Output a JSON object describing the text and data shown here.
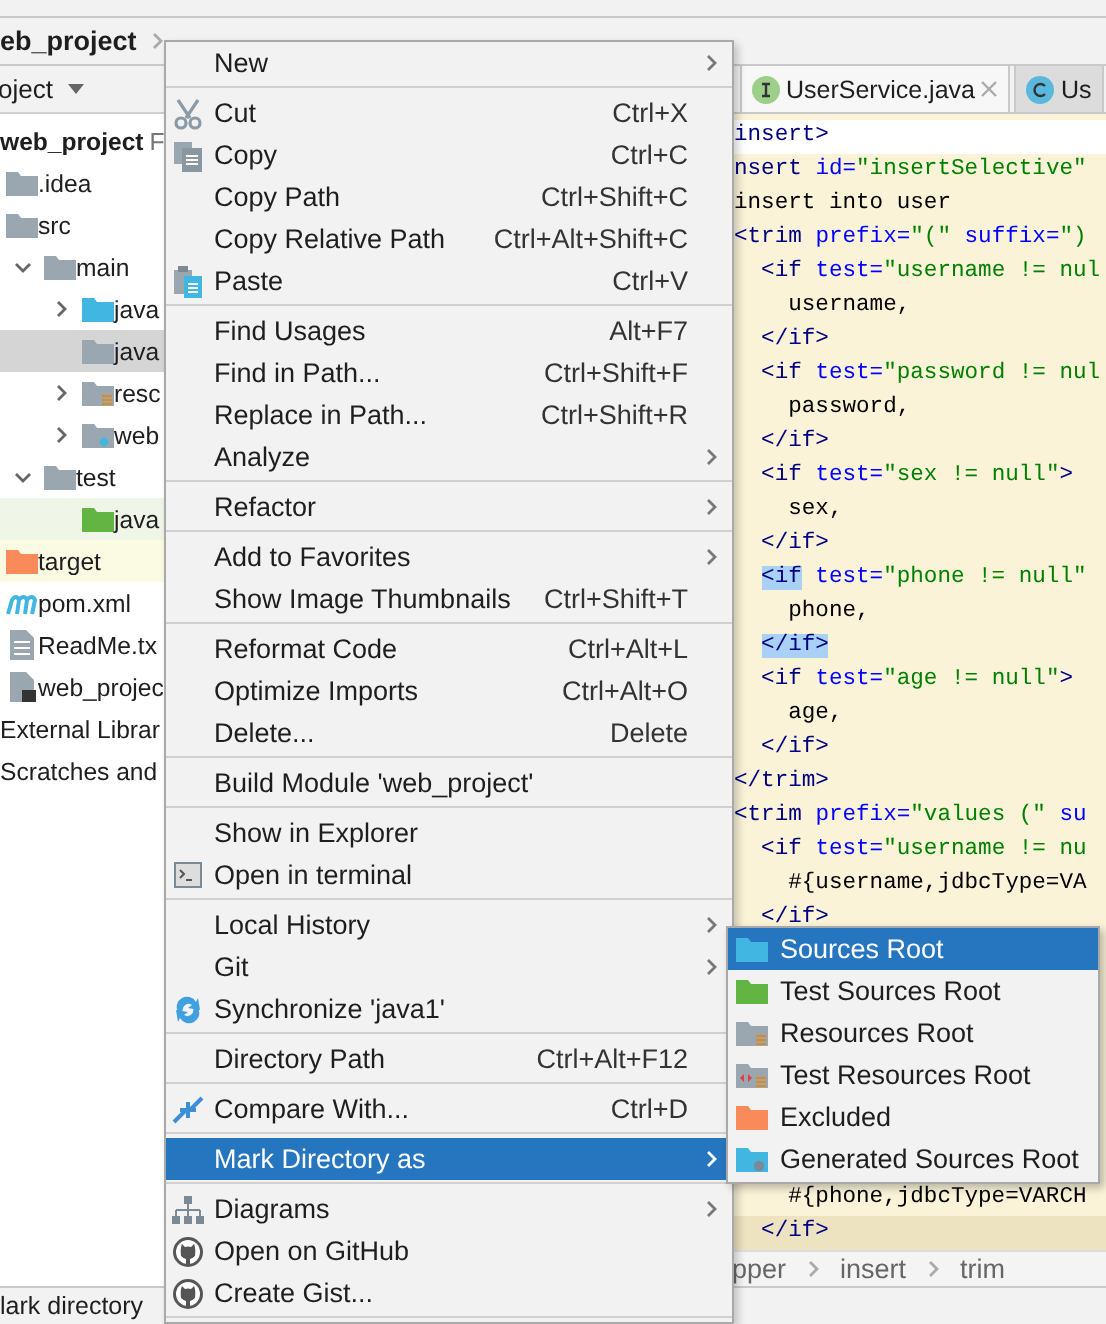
{
  "nav_bar": {
    "project": "eb_project"
  },
  "project_panel": {
    "title": "oject",
    "tree": [
      {
        "label": "web_project",
        "path": "F",
        "selected": false,
        "children": [
          {
            "label": ".idea",
            "kind": "folder",
            "selected": false
          },
          {
            "label": "src",
            "kind": "folder",
            "selected": false,
            "children": [
              {
                "label": "main",
                "kind": "folder",
                "expanded": true,
                "selected": false,
                "children": [
                  {
                    "label": "java",
                    "kind": "source",
                    "expanded": false,
                    "selected": false
                  },
                  {
                    "label": "java",
                    "kind": "folder",
                    "selected": true
                  },
                  {
                    "label": "resc",
                    "kind": "resources",
                    "expanded": false,
                    "selected": false
                  },
                  {
                    "label": "web",
                    "kind": "web",
                    "expanded": false,
                    "selected": false
                  }
                ]
              },
              {
                "label": "test",
                "kind": "folder",
                "expanded": true,
                "selected": false,
                "children": [
                  {
                    "label": "java",
                    "kind": "test",
                    "selected": false,
                    "color": "#eff6e8"
                  }
                ]
              }
            ]
          },
          {
            "label": "target",
            "kind": "excluded",
            "selected": false,
            "color": "#fbfbe3"
          },
          {
            "label": "pom.xml",
            "kind": "maven",
            "selected": false
          },
          {
            "label": "ReadMe.tx",
            "kind": "text",
            "selected": false
          },
          {
            "label": "web_projec",
            "kind": "module",
            "selected": false
          }
        ]
      },
      {
        "label": "External Librar",
        "selected": false
      },
      {
        "label": "Scratches and",
        "selected": false
      }
    ]
  },
  "editor": {
    "tabs": [
      {
        "label": "UserService.java",
        "kind": "interface",
        "closable": true,
        "selected": true
      },
      {
        "label": "Us",
        "kind": "class",
        "closable": false,
        "selected": false
      }
    ],
    "lines": [
      {
        "highlighted": false,
        "tokens": [
          {
            "kind": "tag",
            "text": "insert>"
          }
        ]
      },
      {
        "highlighted": true,
        "tokens": [
          {
            "kind": "tag",
            "text": "nsert "
          },
          {
            "kind": "attr",
            "text": "id="
          },
          {
            "kind": "string",
            "text": "\"insertSelective\""
          }
        ]
      },
      {
        "highlighted": true,
        "tokens": [
          {
            "kind": "text",
            "text": "insert into user"
          }
        ]
      },
      {
        "highlighted": true,
        "tokens": [
          {
            "kind": "tag",
            "text": "<trim "
          },
          {
            "kind": "attr",
            "text": "prefix="
          },
          {
            "kind": "string",
            "text": "\"(\" "
          },
          {
            "kind": "attr",
            "text": "suffix="
          },
          {
            "kind": "string",
            "text": "\")"
          }
        ]
      },
      {
        "highlighted": true,
        "tokens": [
          {
            "kind": "tag",
            "text": "  <if "
          },
          {
            "kind": "attr",
            "text": "test="
          },
          {
            "kind": "string",
            "text": "\"username != nul"
          }
        ]
      },
      {
        "highlighted": true,
        "tokens": [
          {
            "kind": "text",
            "text": "    username,"
          }
        ]
      },
      {
        "highlighted": true,
        "tokens": [
          {
            "kind": "tag",
            "text": "  </if>"
          }
        ]
      },
      {
        "highlighted": true,
        "tokens": [
          {
            "kind": "tag",
            "text": "  <if "
          },
          {
            "kind": "attr",
            "text": "test="
          },
          {
            "kind": "string",
            "text": "\"password != nul"
          }
        ]
      },
      {
        "highlighted": true,
        "tokens": [
          {
            "kind": "text",
            "text": "    password,"
          }
        ]
      },
      {
        "highlighted": true,
        "tokens": [
          {
            "kind": "tag",
            "text": "  </if>"
          }
        ]
      },
      {
        "highlighted": true,
        "tokens": [
          {
            "kind": "tag",
            "text": "  <if "
          },
          {
            "kind": "attr",
            "text": "test="
          },
          {
            "kind": "string",
            "text": "\"sex != null\""
          },
          {
            "kind": "tag",
            "text": ">"
          }
        ]
      },
      {
        "highlighted": true,
        "tokens": [
          {
            "kind": "text",
            "text": "    sex,"
          }
        ]
      },
      {
        "highlighted": true,
        "tokens": [
          {
            "kind": "tag",
            "text": "  </if>"
          }
        ]
      },
      {
        "highlighted": true,
        "tokens": [
          {
            "kind": "match",
            "text": "<if"
          },
          {
            "kind": "attr",
            "text": " test="
          },
          {
            "kind": "string",
            "text": "\"phone != null\""
          }
        ]
      },
      {
        "highlighted": true,
        "tokens": [
          {
            "kind": "text",
            "text": "    phone,"
          }
        ]
      },
      {
        "highlighted": true,
        "tokens": [
          {
            "kind": "match",
            "text": "</if>"
          }
        ]
      },
      {
        "highlighted": true,
        "tokens": [
          {
            "kind": "tag",
            "text": "  <if "
          },
          {
            "kind": "attr",
            "text": "test="
          },
          {
            "kind": "string",
            "text": "\"age != null\""
          },
          {
            "kind": "tag",
            "text": ">"
          }
        ]
      },
      {
        "highlighted": true,
        "tokens": [
          {
            "kind": "text",
            "text": "    age,"
          }
        ]
      },
      {
        "highlighted": true,
        "tokens": [
          {
            "kind": "tag",
            "text": "  </if>"
          }
        ]
      },
      {
        "highlighted": true,
        "tokens": [
          {
            "kind": "tag",
            "text": "</trim>"
          }
        ]
      },
      {
        "highlighted": true,
        "tokens": [
          {
            "kind": "tag",
            "text": "<trim "
          },
          {
            "kind": "attr",
            "text": "prefix="
          },
          {
            "kind": "string",
            "text": "\"values (\" "
          },
          {
            "kind": "attr",
            "text": "su"
          }
        ]
      },
      {
        "highlighted": true,
        "tokens": [
          {
            "kind": "tag",
            "text": "  <if "
          },
          {
            "kind": "attr",
            "text": "test="
          },
          {
            "kind": "string",
            "text": "\"username != nu"
          }
        ]
      },
      {
        "highlighted": true,
        "tokens": [
          {
            "kind": "text",
            "text": "    #{username,jdbcType=VA"
          }
        ]
      },
      {
        "highlighted": true,
        "tokens": [
          {
            "kind": "tag",
            "text": "  </if>"
          }
        ]
      }
    ],
    "lower_lines": [
      {
        "highlighted": true,
        "caret": false,
        "tokens": [
          {
            "kind": "text",
            "text": "    #{phone,jdbcType=VARCH"
          }
        ]
      },
      {
        "highlighted": true,
        "caret": true,
        "tokens": [
          {
            "kind": "tag",
            "text": "  </if>"
          }
        ]
      }
    ],
    "breadcrumbs": [
      "pper",
      "insert",
      "trim"
    ]
  },
  "status_bar": {
    "text": "lark directory"
  },
  "context_menu": {
    "items": [
      {
        "kind": "plain",
        "label": "New",
        "submenu": true,
        "selected": false
      },
      {
        "kind": "separator"
      },
      {
        "kind": "cut",
        "label": "Cut",
        "shortcut": "Ctrl+X",
        "submenu": false,
        "selected": false
      },
      {
        "kind": "copy",
        "label": "Copy",
        "shortcut": "Ctrl+C",
        "submenu": false,
        "selected": false
      },
      {
        "kind": "plain",
        "label": "Copy Path",
        "shortcut": "Ctrl+Shift+C",
        "submenu": false,
        "selected": false
      },
      {
        "kind": "plain",
        "label": "Copy Relative Path",
        "shortcut": "Ctrl+Alt+Shift+C",
        "submenu": false,
        "selected": false
      },
      {
        "kind": "paste",
        "label": "Paste",
        "shortcut": "Ctrl+V",
        "submenu": false,
        "selected": false
      },
      {
        "kind": "separator"
      },
      {
        "kind": "plain",
        "label": "Find Usages",
        "shortcut": "Alt+F7",
        "submenu": false,
        "selected": false
      },
      {
        "kind": "plain",
        "label": "Find in Path...",
        "shortcut": "Ctrl+Shift+F",
        "submenu": false,
        "selected": false
      },
      {
        "kind": "plain",
        "label": "Replace in Path...",
        "shortcut": "Ctrl+Shift+R",
        "submenu": false,
        "selected": false
      },
      {
        "kind": "plain",
        "label": "Analyze",
        "submenu": true,
        "selected": false
      },
      {
        "kind": "separator"
      },
      {
        "kind": "plain",
        "label": "Refactor",
        "submenu": true,
        "selected": false
      },
      {
        "kind": "separator"
      },
      {
        "kind": "plain",
        "label": "Add to Favorites",
        "submenu": true,
        "selected": false
      },
      {
        "kind": "plain",
        "label": "Show Image Thumbnails",
        "shortcut": "Ctrl+Shift+T",
        "submenu": false,
        "selected": false
      },
      {
        "kind": "separator"
      },
      {
        "kind": "plain",
        "label": "Reformat Code",
        "shortcut": "Ctrl+Alt+L",
        "submenu": false,
        "selected": false
      },
      {
        "kind": "plain",
        "label": "Optimize Imports",
        "shortcut": "Ctrl+Alt+O",
        "submenu": false,
        "selected": false
      },
      {
        "kind": "plain",
        "label": "Delete...",
        "shortcut": "Delete",
        "submenu": false,
        "selected": false
      },
      {
        "kind": "separator"
      },
      {
        "kind": "plain",
        "label": "Build Module 'web_project'",
        "submenu": false,
        "selected": false
      },
      {
        "kind": "separator"
      },
      {
        "kind": "plain",
        "label": "Show in Explorer",
        "submenu": false,
        "selected": false
      },
      {
        "kind": "terminal",
        "label": "Open in terminal",
        "submenu": false,
        "selected": false
      },
      {
        "kind": "separator"
      },
      {
        "kind": "plain",
        "label": "Local History",
        "submenu": true,
        "selected": false
      },
      {
        "kind": "plain",
        "label": "Git",
        "submenu": true,
        "selected": false
      },
      {
        "kind": "sync",
        "label": "Synchronize 'java1'",
        "submenu": false,
        "selected": false
      },
      {
        "kind": "separator"
      },
      {
        "kind": "plain",
        "label": "Directory Path",
        "shortcut": "Ctrl+Alt+F12",
        "submenu": false,
        "selected": false
      },
      {
        "kind": "separator"
      },
      {
        "kind": "compare",
        "label": "Compare With...",
        "shortcut": "Ctrl+D",
        "submenu": false,
        "selected": false
      },
      {
        "kind": "separator"
      },
      {
        "kind": "plain",
        "label": "Mark Directory as",
        "submenu": true,
        "selected": true
      },
      {
        "kind": "separator"
      },
      {
        "kind": "diagram",
        "label": "Diagrams",
        "submenu": true,
        "selected": false
      },
      {
        "kind": "github",
        "label": "Open on GitHub",
        "submenu": false,
        "selected": false
      },
      {
        "kind": "github",
        "label": "Create Gist...",
        "submenu": false,
        "selected": false
      },
      {
        "kind": "separator"
      }
    ]
  },
  "submenu": {
    "items": [
      {
        "kind": "source",
        "label": "Sources Root",
        "selected": true
      },
      {
        "kind": "test",
        "label": "Test Sources Root",
        "selected": false
      },
      {
        "kind": "resources",
        "label": "Resources Root",
        "selected": false
      },
      {
        "kind": "test-resources",
        "label": "Test Resources Root",
        "selected": false
      },
      {
        "kind": "excluded",
        "label": "Excluded",
        "selected": false
      },
      {
        "kind": "generated",
        "label": "Generated Sources Root",
        "selected": false
      }
    ]
  }
}
